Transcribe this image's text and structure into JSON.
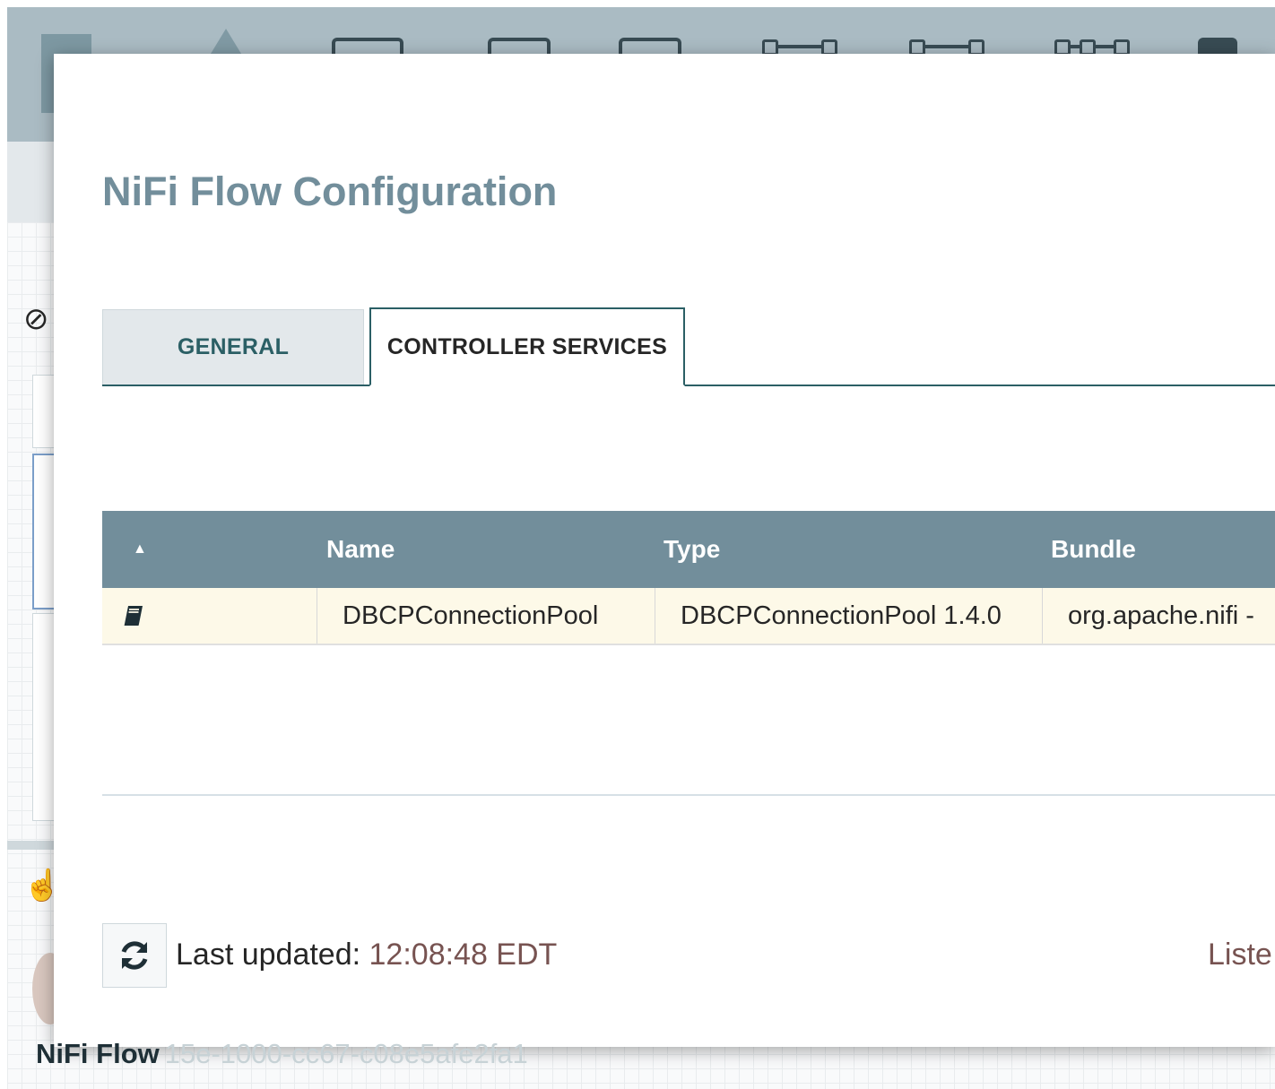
{
  "background": {
    "breadcrumb": {
      "label": "NiFi Flow",
      "group_id": "15e-1000-cc67-c08e5afe2fa1"
    }
  },
  "dialog": {
    "title": "NiFi Flow Configuration",
    "tabs": [
      {
        "label": "GENERAL",
        "selected": false
      },
      {
        "label": "CONTROLLER SERVICES",
        "selected": true
      }
    ],
    "table": {
      "sort_indicator": "▲",
      "columns": [
        "Name",
        "Type",
        "Bundle"
      ],
      "rows": [
        {
          "icon": "documentation-icon",
          "name": "DBCPConnectionPool",
          "type": "DBCPConnectionPool 1.4.0",
          "bundle": "org.apache.nifi - "
        }
      ]
    },
    "footer": {
      "last_updated_label": "Last updated: ",
      "last_updated_time": "12:08:48 EDT",
      "listed_text": "Liste"
    }
  },
  "colors": {
    "header_bg": "#728e9b",
    "title": "#728e9b",
    "tab_accent": "#2b5f65",
    "row_highlight": "#fdf9e8",
    "time_text": "#775351"
  }
}
